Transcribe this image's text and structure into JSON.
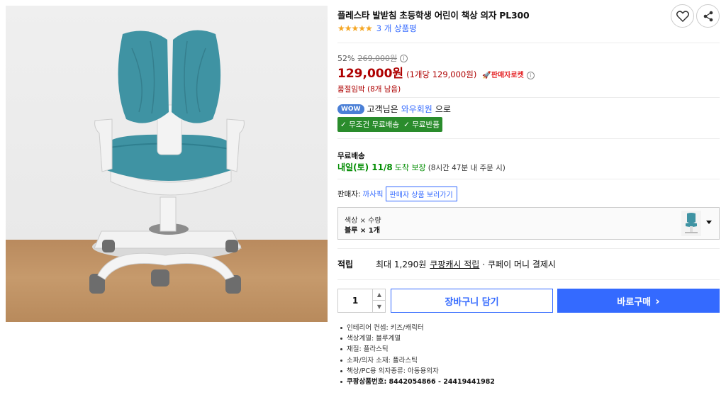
{
  "product": {
    "title": "플레스타 발받침 초등학생 어린이 책상 의자 PL300",
    "rating_stars": "★★★★★",
    "review_count": "3 개 상품평"
  },
  "price": {
    "discount_rate": "52%",
    "original_price": "269,000원",
    "info_icon": "ⓘ",
    "sale_price": "129,000원",
    "unit_price": "(1개당 129,000원)",
    "rocket_badge": "판매자로켓",
    "stock_note": "품절임박 (8개 남음)"
  },
  "membership": {
    "badge": "WOW",
    "text_prefix": "고객님은 ",
    "link": "와우회원",
    "text_suffix": "으로",
    "benefit_1": "✓ 무조건 무료배송",
    "benefit_2": "✓ 무료반품"
  },
  "shipping": {
    "heading": "무료배송",
    "date": "내일(토) 11/8",
    "guarantee": "도착 보장",
    "note": "(8시간 47분 내 주문 시)"
  },
  "seller": {
    "label": "판매자:",
    "name": "까사픽",
    "store_button": "판매자 상품 보러가기"
  },
  "option": {
    "label": "색상 × 수량",
    "value": "블루 × 1개"
  },
  "points": {
    "heading": "적립",
    "max_text": "최대 1,290원",
    "cash_link": "쿠팡캐시 적립",
    "rest": "· 쿠페이 머니 결제시"
  },
  "purchase": {
    "quantity": "1",
    "cart_label": "장바구니 담기",
    "buy_label": "바로구매",
    "buy_chevron": "›"
  },
  "specs": [
    "인테리어 컨셉: 키즈/캐릭터",
    "색상계열: 블루계열",
    "재질: 플라스틱",
    "소파/의자 소재: 플라스틱",
    "책상/PC용 의자종류: 아동용의자",
    "쿠팡상품번호: 8442054866 - 24419441982"
  ],
  "icons": {
    "heart": "heart-icon",
    "share": "share-icon",
    "rocket": "rocket-icon"
  },
  "colors": {
    "accent_blue": "#346aff",
    "price_red": "#ae0000",
    "delivery_green": "#008c00",
    "chair_teal": "#3f93a3"
  }
}
